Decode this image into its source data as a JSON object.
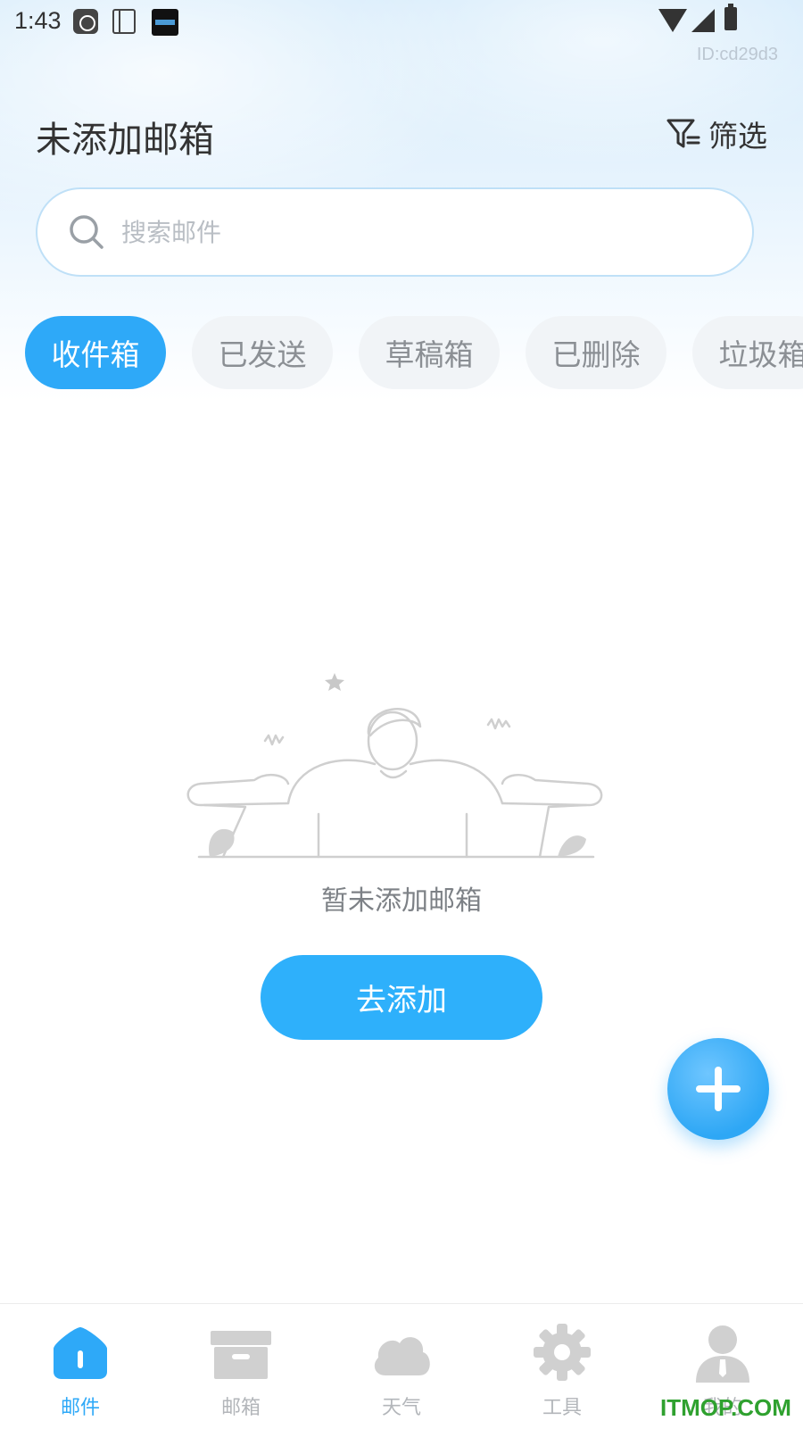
{
  "status_bar": {
    "time": "1:43",
    "icons": [
      "sina-app-icon",
      "notebook-app-icon",
      "clock-app-icon",
      "wifi-icon",
      "signal-icon",
      "battery-charging-icon"
    ]
  },
  "device_id": "ID:cd29d3",
  "header": {
    "title": "未添加邮箱",
    "filter_label": "筛选",
    "filter_icon": "filter-icon"
  },
  "search": {
    "placeholder": "搜索邮件",
    "value": ""
  },
  "tabs": [
    {
      "label": "收件箱",
      "active": true
    },
    {
      "label": "已发送",
      "active": false
    },
    {
      "label": "草稿箱",
      "active": false
    },
    {
      "label": "已删除",
      "active": false
    },
    {
      "label": "垃圾箱",
      "active": false
    }
  ],
  "empty_state": {
    "illustration": "person-shrugging-illustration",
    "message": "暂未添加邮箱",
    "action_label": "去添加"
  },
  "fab": {
    "icon": "plus-icon"
  },
  "bottom_nav": [
    {
      "label": "邮件",
      "icon": "mail-home-icon",
      "active": true
    },
    {
      "label": "邮箱",
      "icon": "mailbox-archive-icon",
      "active": false
    },
    {
      "label": "天气",
      "icon": "weather-cloud-icon",
      "active": false
    },
    {
      "label": "工具",
      "icon": "tools-gear-icon",
      "active": false
    },
    {
      "label": "我的",
      "icon": "profile-person-icon",
      "active": false
    }
  ],
  "watermark": "ITMOP.COM",
  "colors": {
    "accent": "#2ea9f8",
    "inactive_tab_bg": "#f1f4f7",
    "inactive_text": "#b3b6ba"
  }
}
